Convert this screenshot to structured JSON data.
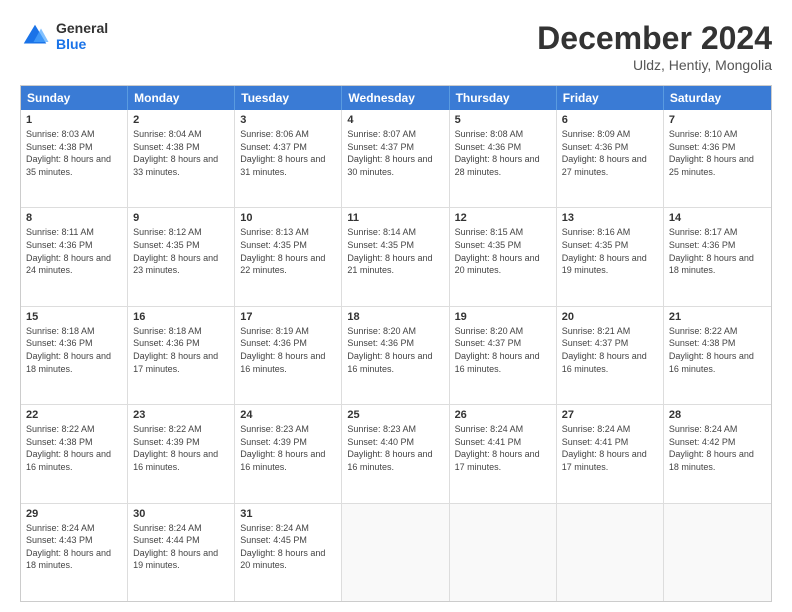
{
  "logo": {
    "line1": "General",
    "line2": "Blue"
  },
  "title": "December 2024",
  "subtitle": "Uldz, Hentiy, Mongolia",
  "header_days": [
    "Sunday",
    "Monday",
    "Tuesday",
    "Wednesday",
    "Thursday",
    "Friday",
    "Saturday"
  ],
  "weeks": [
    [
      {
        "day": "1",
        "sunrise": "Sunrise: 8:03 AM",
        "sunset": "Sunset: 4:38 PM",
        "daylight": "Daylight: 8 hours and 35 minutes."
      },
      {
        "day": "2",
        "sunrise": "Sunrise: 8:04 AM",
        "sunset": "Sunset: 4:38 PM",
        "daylight": "Daylight: 8 hours and 33 minutes."
      },
      {
        "day": "3",
        "sunrise": "Sunrise: 8:06 AM",
        "sunset": "Sunset: 4:37 PM",
        "daylight": "Daylight: 8 hours and 31 minutes."
      },
      {
        "day": "4",
        "sunrise": "Sunrise: 8:07 AM",
        "sunset": "Sunset: 4:37 PM",
        "daylight": "Daylight: 8 hours and 30 minutes."
      },
      {
        "day": "5",
        "sunrise": "Sunrise: 8:08 AM",
        "sunset": "Sunset: 4:36 PM",
        "daylight": "Daylight: 8 hours and 28 minutes."
      },
      {
        "day": "6",
        "sunrise": "Sunrise: 8:09 AM",
        "sunset": "Sunset: 4:36 PM",
        "daylight": "Daylight: 8 hours and 27 minutes."
      },
      {
        "day": "7",
        "sunrise": "Sunrise: 8:10 AM",
        "sunset": "Sunset: 4:36 PM",
        "daylight": "Daylight: 8 hours and 25 minutes."
      }
    ],
    [
      {
        "day": "8",
        "sunrise": "Sunrise: 8:11 AM",
        "sunset": "Sunset: 4:36 PM",
        "daylight": "Daylight: 8 hours and 24 minutes."
      },
      {
        "day": "9",
        "sunrise": "Sunrise: 8:12 AM",
        "sunset": "Sunset: 4:35 PM",
        "daylight": "Daylight: 8 hours and 23 minutes."
      },
      {
        "day": "10",
        "sunrise": "Sunrise: 8:13 AM",
        "sunset": "Sunset: 4:35 PM",
        "daylight": "Daylight: 8 hours and 22 minutes."
      },
      {
        "day": "11",
        "sunrise": "Sunrise: 8:14 AM",
        "sunset": "Sunset: 4:35 PM",
        "daylight": "Daylight: 8 hours and 21 minutes."
      },
      {
        "day": "12",
        "sunrise": "Sunrise: 8:15 AM",
        "sunset": "Sunset: 4:35 PM",
        "daylight": "Daylight: 8 hours and 20 minutes."
      },
      {
        "day": "13",
        "sunrise": "Sunrise: 8:16 AM",
        "sunset": "Sunset: 4:35 PM",
        "daylight": "Daylight: 8 hours and 19 minutes."
      },
      {
        "day": "14",
        "sunrise": "Sunrise: 8:17 AM",
        "sunset": "Sunset: 4:36 PM",
        "daylight": "Daylight: 8 hours and 18 minutes."
      }
    ],
    [
      {
        "day": "15",
        "sunrise": "Sunrise: 8:18 AM",
        "sunset": "Sunset: 4:36 PM",
        "daylight": "Daylight: 8 hours and 18 minutes."
      },
      {
        "day": "16",
        "sunrise": "Sunrise: 8:18 AM",
        "sunset": "Sunset: 4:36 PM",
        "daylight": "Daylight: 8 hours and 17 minutes."
      },
      {
        "day": "17",
        "sunrise": "Sunrise: 8:19 AM",
        "sunset": "Sunset: 4:36 PM",
        "daylight": "Daylight: 8 hours and 16 minutes."
      },
      {
        "day": "18",
        "sunrise": "Sunrise: 8:20 AM",
        "sunset": "Sunset: 4:36 PM",
        "daylight": "Daylight: 8 hours and 16 minutes."
      },
      {
        "day": "19",
        "sunrise": "Sunrise: 8:20 AM",
        "sunset": "Sunset: 4:37 PM",
        "daylight": "Daylight: 8 hours and 16 minutes."
      },
      {
        "day": "20",
        "sunrise": "Sunrise: 8:21 AM",
        "sunset": "Sunset: 4:37 PM",
        "daylight": "Daylight: 8 hours and 16 minutes."
      },
      {
        "day": "21",
        "sunrise": "Sunrise: 8:22 AM",
        "sunset": "Sunset: 4:38 PM",
        "daylight": "Daylight: 8 hours and 16 minutes."
      }
    ],
    [
      {
        "day": "22",
        "sunrise": "Sunrise: 8:22 AM",
        "sunset": "Sunset: 4:38 PM",
        "daylight": "Daylight: 8 hours and 16 minutes."
      },
      {
        "day": "23",
        "sunrise": "Sunrise: 8:22 AM",
        "sunset": "Sunset: 4:39 PM",
        "daylight": "Daylight: 8 hours and 16 minutes."
      },
      {
        "day": "24",
        "sunrise": "Sunrise: 8:23 AM",
        "sunset": "Sunset: 4:39 PM",
        "daylight": "Daylight: 8 hours and 16 minutes."
      },
      {
        "day": "25",
        "sunrise": "Sunrise: 8:23 AM",
        "sunset": "Sunset: 4:40 PM",
        "daylight": "Daylight: 8 hours and 16 minutes."
      },
      {
        "day": "26",
        "sunrise": "Sunrise: 8:24 AM",
        "sunset": "Sunset: 4:41 PM",
        "daylight": "Daylight: 8 hours and 17 minutes."
      },
      {
        "day": "27",
        "sunrise": "Sunrise: 8:24 AM",
        "sunset": "Sunset: 4:41 PM",
        "daylight": "Daylight: 8 hours and 17 minutes."
      },
      {
        "day": "28",
        "sunrise": "Sunrise: 8:24 AM",
        "sunset": "Sunset: 4:42 PM",
        "daylight": "Daylight: 8 hours and 18 minutes."
      }
    ],
    [
      {
        "day": "29",
        "sunrise": "Sunrise: 8:24 AM",
        "sunset": "Sunset: 4:43 PM",
        "daylight": "Daylight: 8 hours and 18 minutes."
      },
      {
        "day": "30",
        "sunrise": "Sunrise: 8:24 AM",
        "sunset": "Sunset: 4:44 PM",
        "daylight": "Daylight: 8 hours and 19 minutes."
      },
      {
        "day": "31",
        "sunrise": "Sunrise: 8:24 AM",
        "sunset": "Sunset: 4:45 PM",
        "daylight": "Daylight: 8 hours and 20 minutes."
      },
      {
        "day": "",
        "sunrise": "",
        "sunset": "",
        "daylight": ""
      },
      {
        "day": "",
        "sunrise": "",
        "sunset": "",
        "daylight": ""
      },
      {
        "day": "",
        "sunrise": "",
        "sunset": "",
        "daylight": ""
      },
      {
        "day": "",
        "sunrise": "",
        "sunset": "",
        "daylight": ""
      }
    ]
  ]
}
